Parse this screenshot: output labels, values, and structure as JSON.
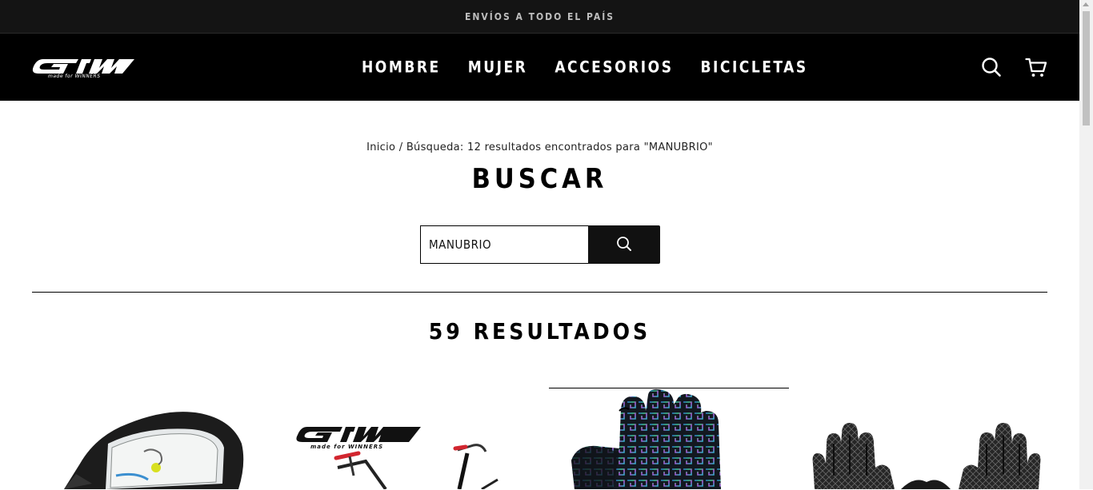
{
  "announcement": {
    "text": "ENVÍOS A TODO EL PAÍS"
  },
  "header": {
    "logo_text": "GW",
    "logo_tagline": "made for WINNERS",
    "nav": [
      {
        "label": "HOMBRE"
      },
      {
        "label": "MUJER"
      },
      {
        "label": "ACCESORIOS"
      },
      {
        "label": "BICICLETAS"
      }
    ],
    "icons": {
      "search": "search-icon",
      "cart": "cart-icon"
    }
  },
  "breadcrumb": {
    "home": "Inicio",
    "separator": "/",
    "current": "Búsqueda: 12 resultados encontrados para \"MANUBRIO\""
  },
  "page": {
    "title": "BUSCAR",
    "results_count": "59 RESULTADOS"
  },
  "search": {
    "value": "MANUBRIO",
    "button_icon": "search-icon"
  },
  "products": [
    {
      "image": "handlebar-phone-bag"
    },
    {
      "image": "gw-bicycle"
    },
    {
      "image": "iridescent-cycling-glove"
    },
    {
      "image": "black-gloves-pair"
    }
  ],
  "colors": {
    "header_bg": "#000000",
    "announce_bg": "#141414",
    "accent": "#111111"
  }
}
